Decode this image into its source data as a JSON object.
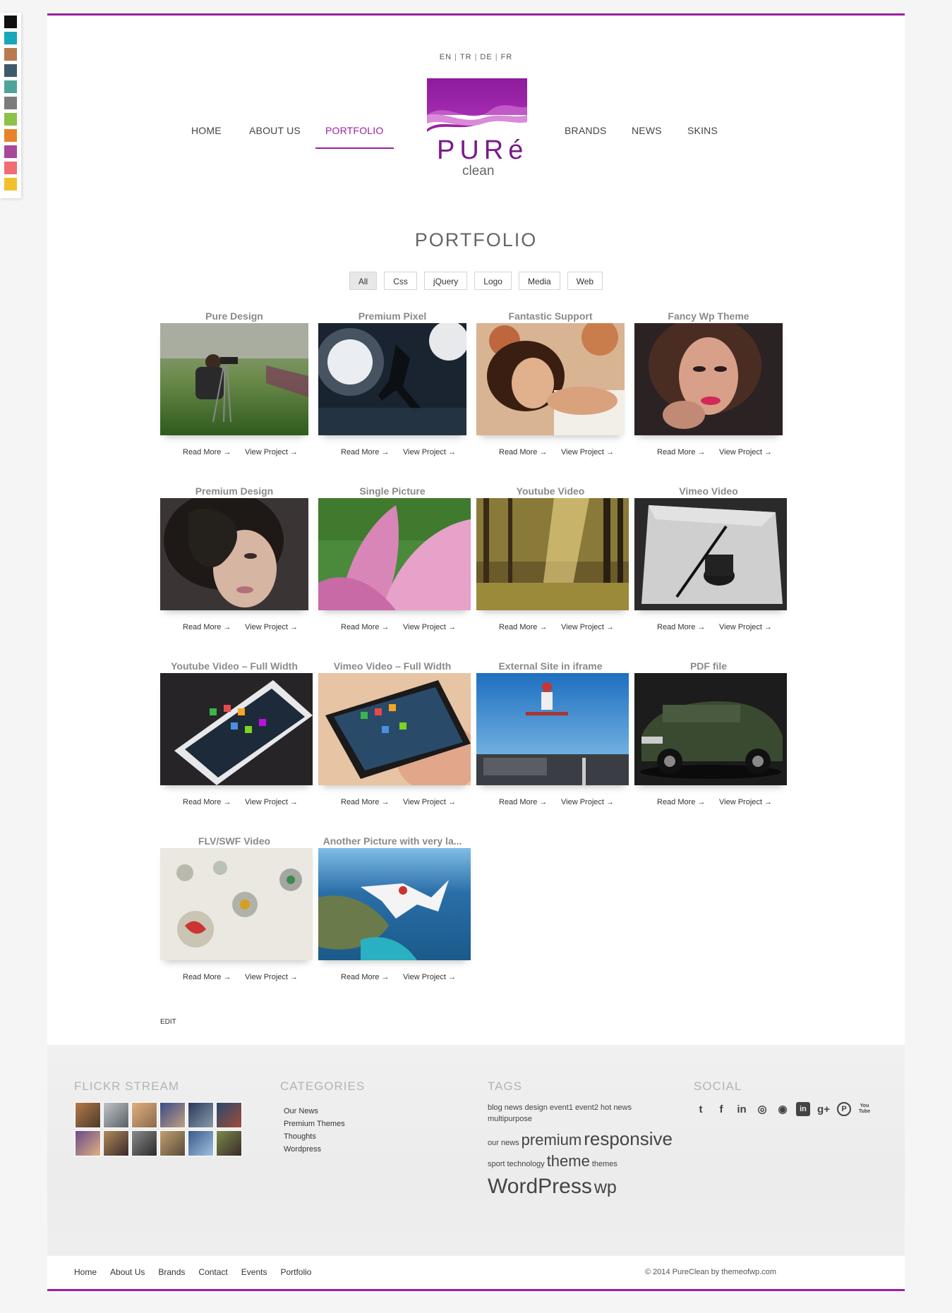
{
  "skins": [
    "#111111",
    "#16a9b9",
    "#b97a4e",
    "#3f5a6a",
    "#4fa39a",
    "#7c7c7c",
    "#8bc34a",
    "#e8832a",
    "#a8489a",
    "#ef6d73",
    "#f0c12c"
  ],
  "brand": {
    "accent": "#9c1fa3",
    "logo_word": "PURé",
    "logo_sub": "clean"
  },
  "languages": [
    "EN",
    "TR",
    "DE",
    "FR"
  ],
  "nav": {
    "home": "HOME",
    "about": "ABOUT US",
    "portfolio": "PORTFOLIO",
    "brands": "BRANDS",
    "news": "NEWS",
    "skins": "SKINS"
  },
  "page_title": "PORTFOLIO",
  "filters": [
    "All",
    "Css",
    "jQuery",
    "Logo",
    "Media",
    "Web"
  ],
  "items": [
    {
      "title": "Pure Design"
    },
    {
      "title": "Premium Pixel"
    },
    {
      "title": "Fantastic Support"
    },
    {
      "title": "Fancy Wp Theme"
    },
    {
      "title": "Premium Design"
    },
    {
      "title": "Single Picture"
    },
    {
      "title": "Youtube Video"
    },
    {
      "title": "Vimeo Video"
    },
    {
      "title": "Youtube Video – Full Width"
    },
    {
      "title": "Vimeo Video – Full Width"
    },
    {
      "title": "External Site in iframe"
    },
    {
      "title": "PDF file"
    },
    {
      "title": "FLV/SWF Video"
    },
    {
      "title": "Another Picture with very la..."
    }
  ],
  "item_links": {
    "read_more": "Read More →",
    "view_project": "View Project →"
  },
  "edit_label": "EDIT",
  "footer": {
    "flickr_title": "FLICKR STREAM",
    "categories_title": "CATEGORIES",
    "categories": [
      "Our News",
      "Premium Themes",
      "Thoughts",
      "Wordpress"
    ],
    "tags_title": "TAGS",
    "tags": {
      "blog": "blog",
      "news": "news",
      "design": "design",
      "event1": "event1",
      "event2": "event2",
      "hot_news": "hot news",
      "multipurpose": "multipurpose",
      "our_news": "our news",
      "premium": "premium",
      "responsive": "responsive",
      "sport": "sport",
      "technology": "technology",
      "theme": "theme",
      "themes": "themes",
      "wordpress": "WordPress",
      "wp": "wp"
    },
    "social_title": "SOCIAL",
    "social_icons": [
      "twitter-icon",
      "facebook-icon",
      "linkedin-icon",
      "dribbble-icon",
      "github-icon",
      "linkedin-box-icon",
      "google-plus-icon",
      "pinterest-icon",
      "youtube-icon"
    ],
    "social_glyphs": {
      "twitter": "t",
      "facebook": "f",
      "linkedin": "in",
      "dribbble": "◎",
      "github": "◉",
      "linkedin_box": "in",
      "gplus": "g+",
      "pinterest": "P",
      "youtube": "You Tube"
    }
  },
  "bottom_nav": [
    "Home",
    "About Us",
    "Brands",
    "Contact",
    "Events",
    "Portfolio"
  ],
  "copyright": "© 2014 PureClean by themeofwp.com"
}
